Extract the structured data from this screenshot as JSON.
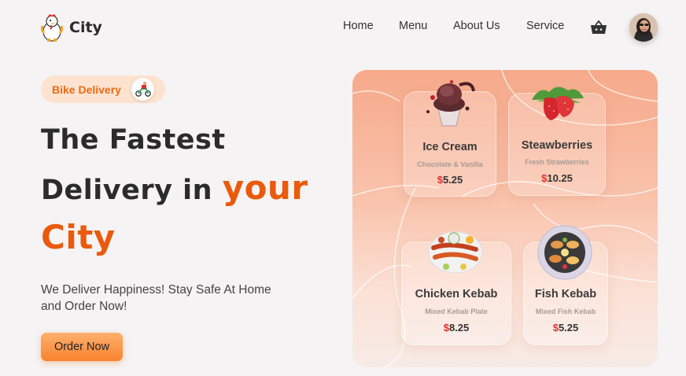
{
  "brand": {
    "name": "City"
  },
  "nav": {
    "items": [
      {
        "label": "Home"
      },
      {
        "label": "Menu"
      },
      {
        "label": "About Us"
      },
      {
        "label": "Service"
      }
    ]
  },
  "hero": {
    "badge": "Bike Delivery",
    "title_line1": "The Fastest",
    "title_line2_plain": "Delivery in",
    "title_line2_accent": "your",
    "title_line3_accent": "City",
    "tagline": "We Deliver Happiness! Stay Safe At Home and Order Now!",
    "cta": "Order Now"
  },
  "colors": {
    "accent": "#ea5a0c",
    "badge_bg": "#fde3cf",
    "price_currency": "#e0322a"
  },
  "menu": [
    {
      "name": "Ice Cream",
      "desc": "Chocolate & Vanilla",
      "currency": "$",
      "price": "5.25",
      "image": "ice-cream-icon"
    },
    {
      "name": "Steawberries",
      "desc": "Fresh Strawberries",
      "currency": "$",
      "price": "10.25",
      "image": "strawberry-icon"
    },
    {
      "name": "Chicken Kebab",
      "desc": "Mixed Kebab Plate",
      "currency": "$",
      "price": "8.25",
      "image": "kebab-plate-icon"
    },
    {
      "name": "Fish Kebab",
      "desc": "Mixed Fish Kebab",
      "currency": "$",
      "price": "5.25",
      "image": "fish-plate-icon"
    }
  ]
}
